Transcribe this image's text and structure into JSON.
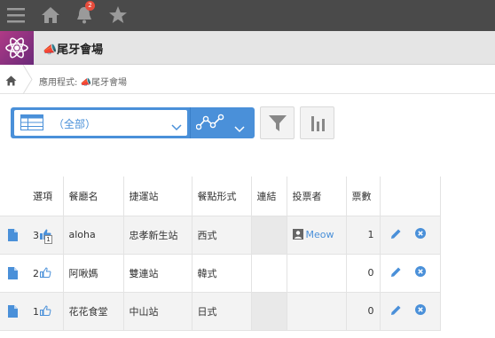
{
  "topbar": {
    "notification_count": "2"
  },
  "app": {
    "title": "📣尾牙會場"
  },
  "breadcrumb": {
    "text": "應用程式: 📣尾牙會場"
  },
  "view": {
    "selected": "（全部）"
  },
  "table": {
    "headers": [
      "選項",
      "餐廳名",
      "捷運站",
      "餐點形式",
      "連結",
      "投票者",
      "票數"
    ],
    "rows": [
      {
        "option_num": "3",
        "liked": true,
        "like_badge": "1",
        "name": "aloha",
        "station": "忠孝新生站",
        "style": "西式",
        "voter": "Meow",
        "votes": "1"
      },
      {
        "option_num": "2",
        "liked": false,
        "like_badge": "",
        "name": "阿啾媽",
        "station": "雙連站",
        "style": "韓式",
        "voter": "",
        "votes": "0"
      },
      {
        "option_num": "1",
        "liked": false,
        "like_badge": "",
        "name": "花花食堂",
        "station": "中山站",
        "style": "日式",
        "voter": "",
        "votes": "0"
      }
    ]
  },
  "colors": {
    "accent": "#4a90d9",
    "topbar": "#4a4a4a",
    "badge": "#e74c3c"
  }
}
